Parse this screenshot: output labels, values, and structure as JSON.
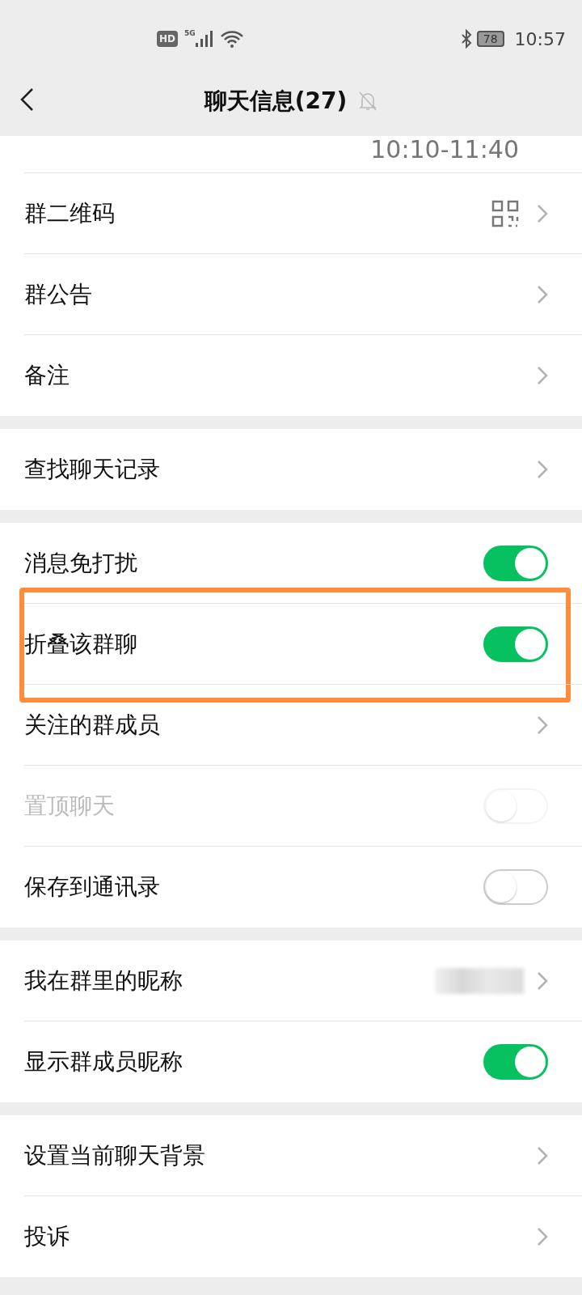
{
  "status_bar": {
    "hd_badge": "HD",
    "network": "5G",
    "battery": "78",
    "time": "10:57"
  },
  "header": {
    "title": "聊天信息(27)",
    "muted": true
  },
  "sections": [
    {
      "rows": [
        {
          "kind": "value",
          "value": "10:10-11:40"
        },
        {
          "kind": "qr",
          "label": "群二维码"
        },
        {
          "kind": "nav",
          "label": "群公告"
        },
        {
          "kind": "nav",
          "label": "备注"
        }
      ]
    },
    {
      "rows": [
        {
          "kind": "nav",
          "label": "查找聊天记录"
        }
      ]
    },
    {
      "rows": [
        {
          "kind": "toggle",
          "label": "消息免打扰",
          "on": true,
          "disabled": false,
          "highlighted": false
        },
        {
          "kind": "toggle",
          "label": "折叠该群聊",
          "on": true,
          "disabled": false,
          "highlighted": true
        },
        {
          "kind": "nav",
          "label": "关注的群成员"
        },
        {
          "kind": "toggle",
          "label": "置顶聊天",
          "on": false,
          "disabled": true,
          "highlighted": false
        },
        {
          "kind": "toggle",
          "label": "保存到通讯录",
          "on": false,
          "disabled": false,
          "highlighted": false
        }
      ]
    },
    {
      "rows": [
        {
          "kind": "blurred",
          "label": "我在群里的昵称"
        },
        {
          "kind": "toggle",
          "label": "显示群成员昵称",
          "on": true,
          "disabled": false,
          "highlighted": false
        }
      ]
    },
    {
      "rows": [
        {
          "kind": "nav",
          "label": "设置当前聊天背景"
        },
        {
          "kind": "nav",
          "label": "投诉"
        }
      ]
    }
  ]
}
